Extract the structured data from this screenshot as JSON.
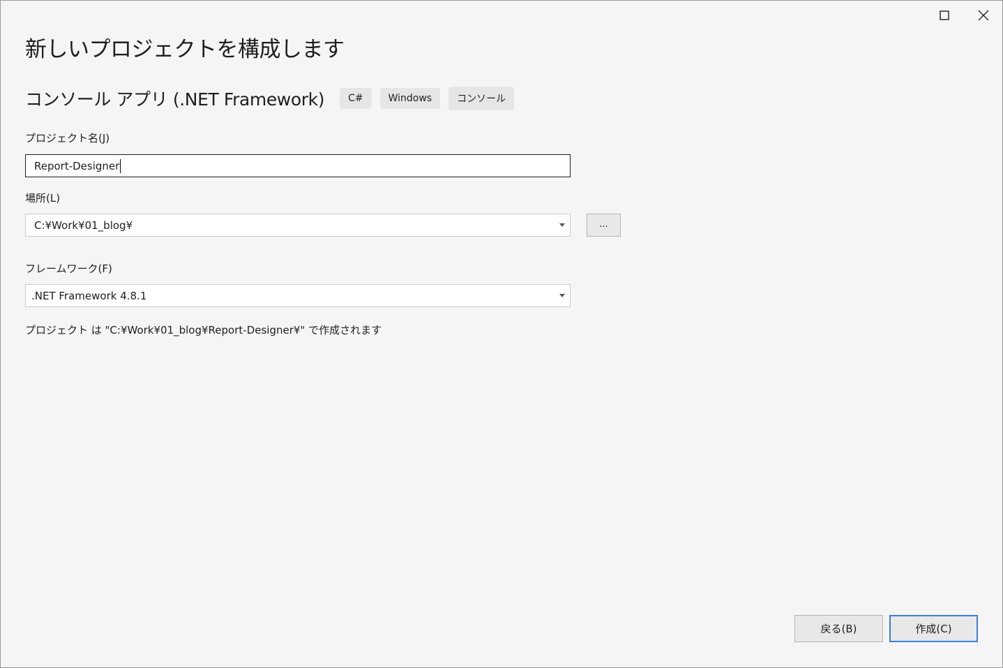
{
  "window": {
    "maximize_icon": "maximize-icon",
    "close_icon": "close-icon"
  },
  "page_title": "新しいプロジェクトを構成します",
  "template": {
    "name": "コンソール アプリ (.NET Framework)",
    "tags": [
      "C#",
      "Windows",
      "コンソール"
    ]
  },
  "project_name": {
    "label": "プロジェクト名(J)",
    "value": "Report-Designer"
  },
  "location": {
    "label": "場所(L)",
    "value": "C:¥Work¥01_blog¥",
    "browse_label": "..."
  },
  "framework": {
    "label": "フレームワーク(F)",
    "value": ".NET Framework 4.8.1"
  },
  "info_text": "プロジェクト は \"C:¥Work¥01_blog¥Report-Designer¥\" で作成されます",
  "buttons": {
    "back": "戻る(B)",
    "create": "作成(C)"
  },
  "colors": {
    "background": "#f5f5f5",
    "accent": "#3c7fd6",
    "tag_background": "#e6e6e6"
  }
}
